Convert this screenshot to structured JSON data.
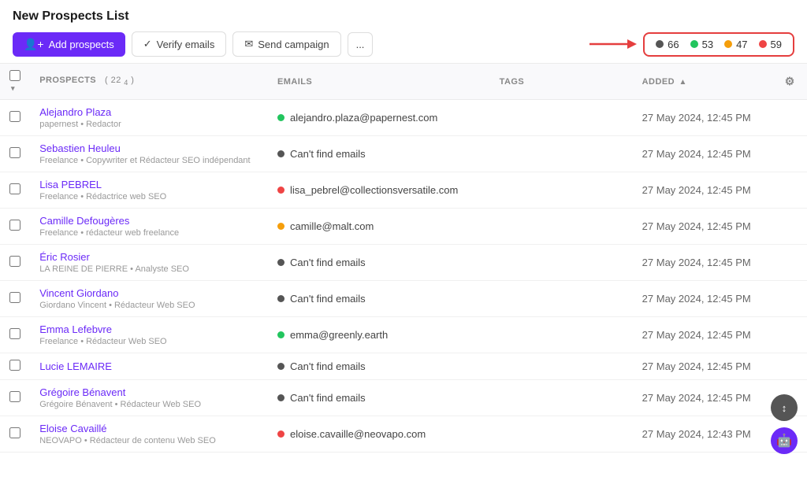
{
  "page": {
    "title": "New Prospects List"
  },
  "toolbar": {
    "add_prospects": "Add prospects",
    "verify_emails": "Verify emails",
    "send_campaign": "Send campaign",
    "more": "..."
  },
  "stats": {
    "s1": {
      "count": "66",
      "color": "#555555"
    },
    "s2": {
      "count": "53",
      "color": "#22c55e"
    },
    "s3": {
      "count": "47",
      "color": "#f59e0b"
    },
    "s4": {
      "count": "59",
      "color": "#ef4444"
    }
  },
  "table": {
    "headers": {
      "select": "",
      "prospects": "PROSPECTS",
      "prospects_count": "22",
      "prospects_sub": "4",
      "emails": "EMAILS",
      "tags": "TAGS",
      "added": "ADDED"
    },
    "rows": [
      {
        "name": "Alejandro Plaza",
        "sub": "papernest • Redactor",
        "email": "alejandro.plaza@papernest.com",
        "email_status": "green",
        "tags": "",
        "added": "27 May 2024, 12:45 PM"
      },
      {
        "name": "Sebastien Heuleu",
        "sub": "Freelance • Copywriter et Rédacteur SEO indépendant",
        "email": "Can't find emails",
        "email_status": "dark",
        "tags": "",
        "added": "27 May 2024, 12:45 PM"
      },
      {
        "name": "Lisa PEBREL",
        "sub": "Freelance • Rédactrice web SEO",
        "email": "lisa_pebrel@collectionsversatile.com",
        "email_status": "red",
        "tags": "",
        "added": "27 May 2024, 12:45 PM"
      },
      {
        "name": "Camille Defougères",
        "sub": "Freelance • rédacteur web freelance",
        "email": "camille@malt.com",
        "email_status": "yellow",
        "tags": "",
        "added": "27 May 2024, 12:45 PM"
      },
      {
        "name": "Éric Rosier",
        "sub": "LA REINE DE PIERRE • Analyste SEO",
        "email": "Can't find emails",
        "email_status": "dark",
        "tags": "",
        "added": "27 May 2024, 12:45 PM"
      },
      {
        "name": "Vincent Giordano",
        "sub": "Giordano Vincent • Rédacteur Web SEO",
        "email": "Can't find emails",
        "email_status": "dark",
        "tags": "",
        "added": "27 May 2024, 12:45 PM"
      },
      {
        "name": "Emma Lefebvre",
        "sub": "Freelance • Rédacteur Web SEO",
        "email": "emma@greenly.earth",
        "email_status": "green",
        "tags": "",
        "added": "27 May 2024, 12:45 PM"
      },
      {
        "name": "Lucie LEMAIRE",
        "sub": "",
        "email": "Can't find emails",
        "email_status": "dark",
        "tags": "",
        "added": "27 May 2024, 12:45 PM"
      },
      {
        "name": "Grégoire Bénavent",
        "sub": "Grégoire Bénavent • Rédacteur Web SEO",
        "email": "Can't find emails",
        "email_status": "dark",
        "tags": "",
        "added": "27 May 2024, 12:45 PM"
      },
      {
        "name": "Eloise Cavaillé",
        "sub": "NEOVAPO • Rédacteur de contenu Web SEO",
        "email": "eloise.cavaille@neovapo.com",
        "email_status": "red",
        "tags": "",
        "added": "27 May 2024, 12:43 PM"
      }
    ]
  }
}
